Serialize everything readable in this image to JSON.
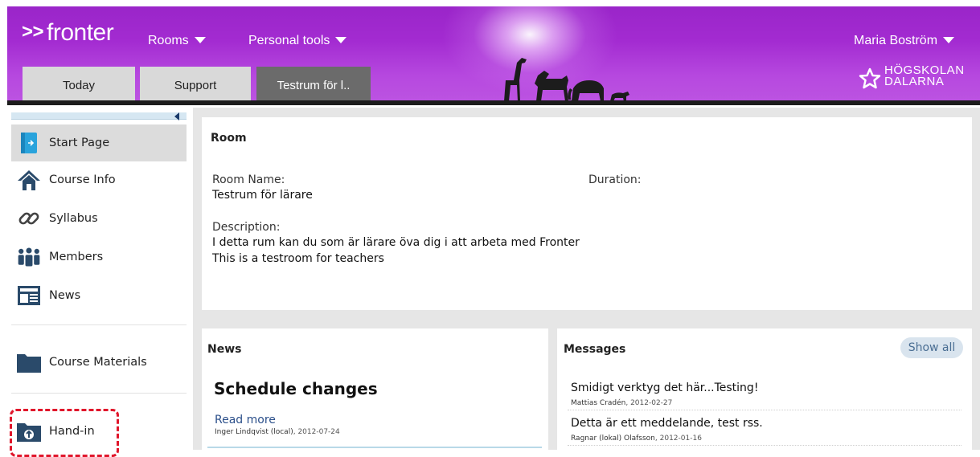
{
  "header": {
    "logo": "fronter",
    "logo_arrows": ">>",
    "menus": {
      "rooms": "Rooms",
      "personal_tools": "Personal tools",
      "user": "Maria Boström"
    },
    "tabs": [
      {
        "label": "Today"
      },
      {
        "label": "Support"
      },
      {
        "label": "Testrum för l.."
      }
    ],
    "school_line1": "HÖGSKOLAN",
    "school_line2": "DALARNA"
  },
  "sidebar": {
    "items": [
      {
        "label": "Start Page",
        "icon": "start-page-icon"
      },
      {
        "label": "Course Info",
        "icon": "house-icon"
      },
      {
        "label": "Syllabus",
        "icon": "link-icon"
      },
      {
        "label": "Members",
        "icon": "members-icon"
      },
      {
        "label": "News",
        "icon": "news-icon"
      },
      {
        "label": "Course Materials",
        "icon": "folder-icon"
      },
      {
        "label": "Hand-in",
        "icon": "hand-in-folder-icon"
      }
    ]
  },
  "room": {
    "title": "Room",
    "name_label": "Room Name:",
    "name_value": "Testrum för lärare",
    "duration_label": "Duration:",
    "description_label": "Description:",
    "description_line1": "I detta rum kan du som är lärare öva dig i att arbeta med Fronter",
    "description_line2": "This is a testroom for teachers"
  },
  "news": {
    "title": "News",
    "headline": "Schedule changes",
    "read_more": "Read more",
    "author": "Inger Lindqvist (local)",
    "date": ", 2012-07-24"
  },
  "messages": {
    "title": "Messages",
    "show_all": "Show all",
    "items": [
      {
        "text": "Smidigt verktyg det här...Testing!",
        "author": "Mattias Cradén",
        "date": ",  2012-02-27"
      },
      {
        "text": "Detta är ett meddelande, test rss.",
        "author": "Ragnar (lokal) Olafsson",
        "date": ",  2012-01-16"
      }
    ]
  },
  "colors": {
    "header_purple": "#a32bd1",
    "highlight_dash": "#e0162b",
    "active_tab": "#6b6b6b"
  }
}
